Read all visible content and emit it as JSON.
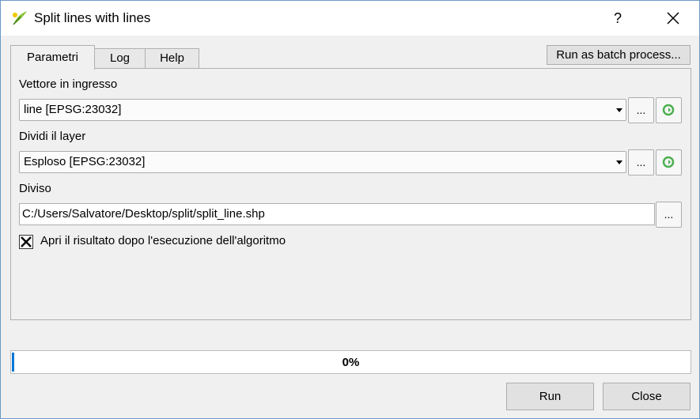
{
  "window": {
    "title": "Split lines with lines",
    "help_symbol": "?",
    "app_icon": "qgis-icon",
    "close_icon": "close-icon"
  },
  "tabs": [
    {
      "label": "Parametri",
      "active": true
    },
    {
      "label": "Log",
      "active": false
    },
    {
      "label": "Help",
      "active": false
    }
  ],
  "batch_button": "Run as batch process...",
  "params": {
    "input_label": "Vettore in ingresso",
    "input_value": "line [EPSG:23032]",
    "split_label": "Dividi il layer",
    "split_value": "Esploso [EPSG:23032]",
    "output_label": "Diviso",
    "output_value": "C:/Users/Salvatore/Desktop/split/split_line.shp",
    "browse_label": "...",
    "open_result_label": "Apri il risultato dopo l'esecuzione dell'algoritmo",
    "open_result_checked": true
  },
  "progress": {
    "text": "0%",
    "value": 0
  },
  "buttons": {
    "run": "Run",
    "close": "Close"
  },
  "colors": {
    "accent": "#0078d7",
    "refresh_icon": "#4caf50"
  }
}
